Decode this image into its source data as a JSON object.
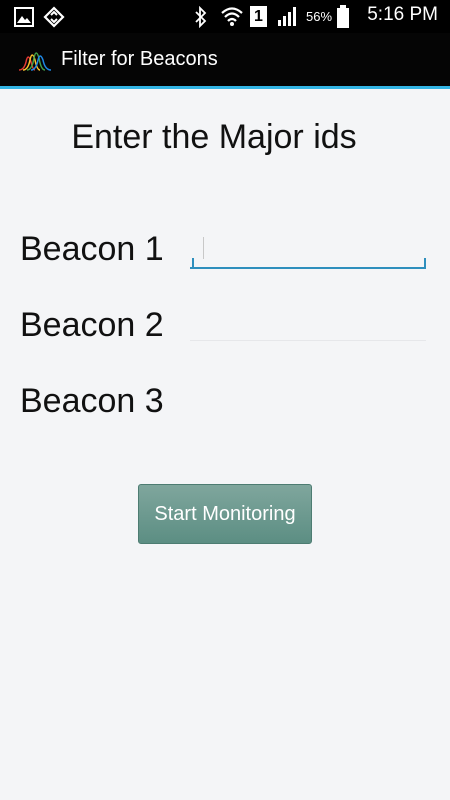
{
  "status_bar": {
    "battery_percent": "56%",
    "time": "5:16 PM",
    "sim_slot": "1",
    "icons": [
      "gallery-icon",
      "sync-icon",
      "bluetooth-icon",
      "wifi-icon",
      "sim-icon",
      "signal-icon",
      "battery-icon"
    ]
  },
  "action_bar": {
    "title": "Filter for Beacons",
    "logo_icon": "waveform-logo-icon",
    "accent_color": "#33b5e5"
  },
  "main": {
    "heading": "Enter the Major ids",
    "beacons": [
      {
        "label": "Beacon 1",
        "value": ""
      },
      {
        "label": "Beacon 2",
        "value": ""
      },
      {
        "label": "Beacon 3",
        "value": ""
      }
    ],
    "start_button": "Start Monitoring",
    "button_color": "#6f9b91"
  }
}
